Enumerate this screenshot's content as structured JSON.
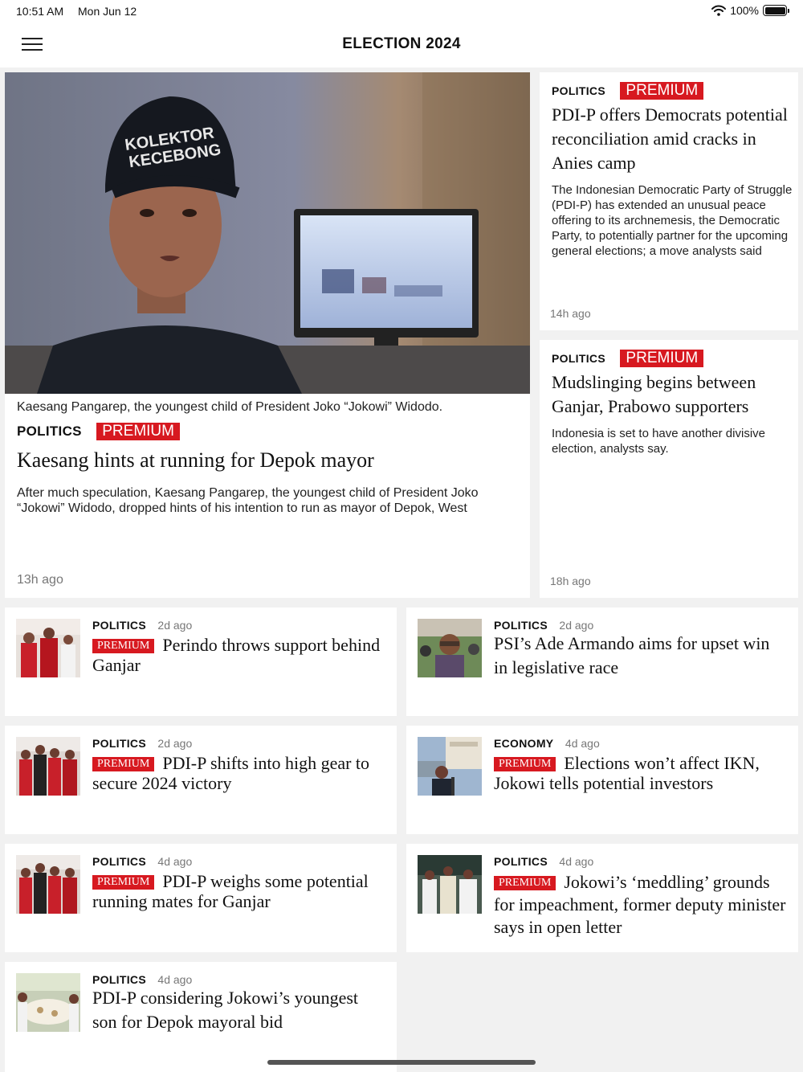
{
  "status": {
    "time": "10:51 AM",
    "date": "Mon Jun 12",
    "battery": "100%"
  },
  "topbar": {
    "title": "ELECTION 2024",
    "menu_icon": "hamburger-menu-icon"
  },
  "premium_label": "PREMIUM",
  "hero": {
    "caption": "Kaesang Pangarep, the youngest child of President Joko “Jokowi” Widodo.",
    "category": "POLITICS",
    "headline": "Kaesang hints at running for Depok mayor",
    "summary": "After much speculation, Kaesang Pangarep, the youngest child of President Joko “Jokowi” Widodo, dropped hints of his intention to run as mayor of Depok, West",
    "ago": "13h ago",
    "cap_text": "KOLEKTOR KECEBONG"
  },
  "side": [
    {
      "category": "POLITICS",
      "headline": "PDI-P offers Democrats potential reconciliation amid cracks in Anies camp",
      "summary": "The Indonesian Democratic Party of Struggle (PDI-P) has extended an unusual peace offering to its archnemesis, the Democratic Party, to potentially partner for the upcoming general elections; a move analysts said",
      "ago": "14h ago"
    },
    {
      "category": "POLITICS",
      "headline": "Mudslinging begins between Ganjar, Prabowo supporters",
      "summary": "Indonesia is set to have another divisive election, analysts say.",
      "ago": "18h ago"
    }
  ],
  "list": [
    {
      "category": "POLITICS",
      "ago": "2d ago",
      "premium": true,
      "headline": "Perindo throws support behind Ganjar"
    },
    {
      "category": "POLITICS",
      "ago": "2d ago",
      "premium": false,
      "headline": "PSI’s Ade Armando aims for upset win in legislative race"
    },
    {
      "category": "POLITICS",
      "ago": "2d ago",
      "premium": true,
      "headline": "PDI-P shifts into high gear to secure 2024 victory"
    },
    {
      "category": "ECONOMY",
      "ago": "4d ago",
      "premium": true,
      "headline": "Elections won’t affect IKN, Jokowi tells potential investors"
    },
    {
      "category": "POLITICS",
      "ago": "4d ago",
      "premium": true,
      "headline": "PDI-P weighs some potential running mates for Ganjar"
    },
    {
      "category": "POLITICS",
      "ago": "4d ago",
      "premium": true,
      "headline": "Jokowi’s ‘meddling’ grounds for impeachment, former deputy minister says in open letter"
    },
    {
      "category": "POLITICS",
      "ago": "4d ago",
      "premium": false,
      "headline": "PDI-P considering Jokowi’s youngest son for Depok mayoral bid"
    }
  ],
  "colors": {
    "accent": "#d71920",
    "background": "#f1f1f1",
    "card": "#ffffff"
  }
}
